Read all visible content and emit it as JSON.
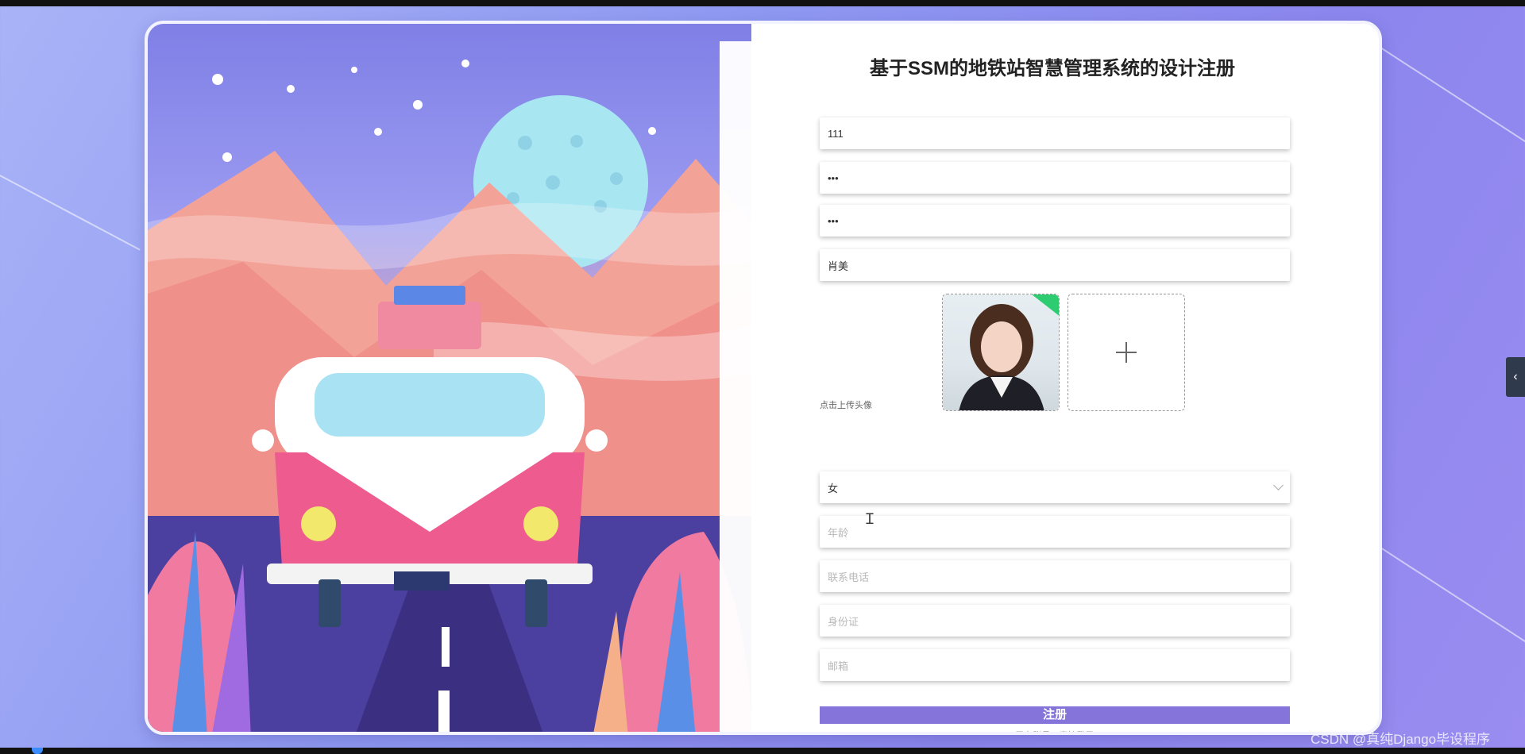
{
  "app": {
    "title": "基于SSM的地铁站智慧管理系统的设计注册"
  },
  "form": {
    "username_value": "111",
    "password_value": "•••",
    "confirm_password_value": "•••",
    "name_value": "肖美",
    "avatar_hint": "点击上传头像",
    "gender_value": "女",
    "age_placeholder": "年龄",
    "phone_placeholder": "联系电话",
    "idcard_placeholder": "身份证",
    "email_placeholder": "邮箱",
    "submit_label": "注册",
    "login_link": "已有账号，直接登录"
  },
  "watermark": "CSDN @真纯Django毕设程序",
  "side_tab_icon": "chevron-left-icon",
  "colors": {
    "accent": "#8574d9",
    "background": "#8e98f1"
  }
}
